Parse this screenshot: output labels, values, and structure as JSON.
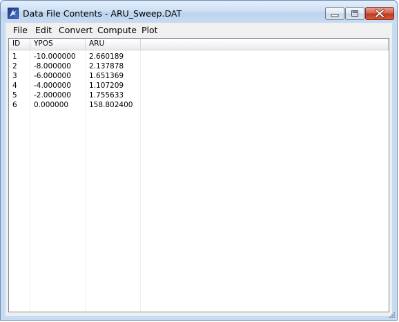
{
  "window": {
    "title": "Data File Contents - ARU_Sweep.DAT"
  },
  "menu": {
    "items": [
      "File",
      "Edit",
      "Convert",
      "Compute",
      "Plot"
    ]
  },
  "table": {
    "columns": [
      "ID",
      "YPOS",
      "ARU"
    ],
    "rows": [
      [
        "1",
        "-10.000000",
        "2.660189"
      ],
      [
        "2",
        "-8.000000",
        "2.137878"
      ],
      [
        "3",
        "-6.000000",
        "1.651369"
      ],
      [
        "4",
        "-4.000000",
        "1.107209"
      ],
      [
        "5",
        "-2.000000",
        "1.755633"
      ],
      [
        "6",
        "0.000000",
        "158.802400"
      ]
    ]
  },
  "icons": {
    "app": "app-icon",
    "minimize": "minimize-icon",
    "maximize": "maximize-icon",
    "close": "close-icon"
  }
}
